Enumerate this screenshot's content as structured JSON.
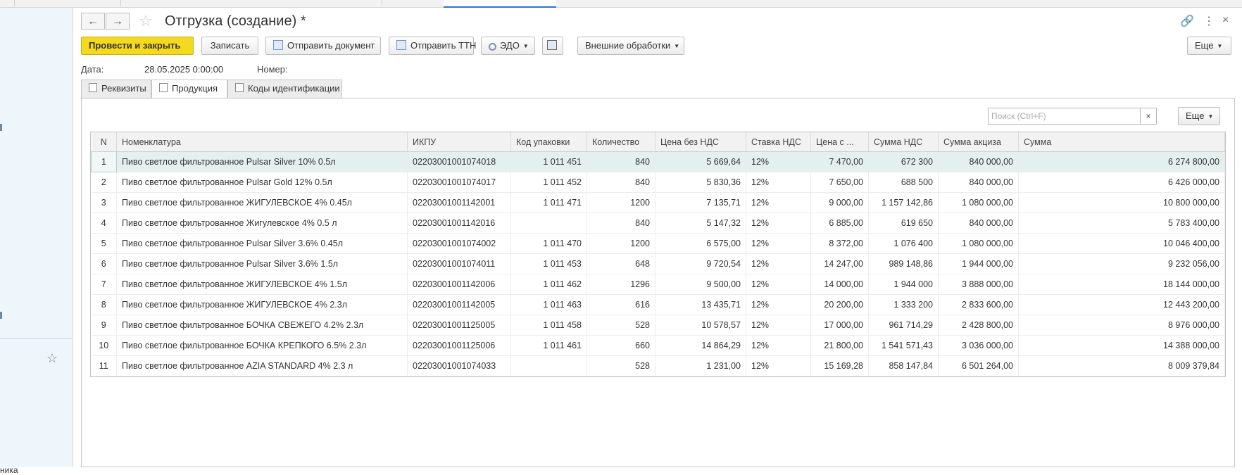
{
  "header": {
    "title": "Отгрузка (создание) *",
    "back_icon": "←",
    "forward_icon": "→",
    "star_icon": "☆",
    "link_icon": "🔗",
    "menu_icon": "⋮",
    "close_icon": "×"
  },
  "toolbar": {
    "post_close": "Провести и закрыть",
    "write": "Записать",
    "send_doc": "Отправить документ",
    "send_ttn": "Отправить ТТН",
    "edo": "ЭДО",
    "external": "Внешние обработки",
    "more": "Еще"
  },
  "fields": {
    "date_label": "Дата:",
    "date_value": "28.05.2025  0:00:00",
    "number_label": "Номер:",
    "number_value": ""
  },
  "tabs": [
    {
      "label": "Реквизиты"
    },
    {
      "label": "Продукция"
    },
    {
      "label": "Коды идентификации"
    }
  ],
  "search": {
    "placeholder": "Поиск (Ctrl+F)",
    "clear": "×",
    "more": "Еще"
  },
  "left_panel": {
    "star": "☆",
    "fragment": "ника"
  },
  "table": {
    "columns": [
      "N",
      "Номенклатура",
      "ИКПУ",
      "Код упаковки",
      "Количество",
      "Цена без НДС",
      "Ставка НДС",
      "Цена с ...",
      "Сумма НДС",
      "Сумма акциза",
      "Сумма"
    ],
    "rows": [
      [
        "1",
        "Пиво светлое фильтрованное Pulsar Silver 10% 0.5л",
        "02203001001074018",
        "1 011 451",
        "840",
        "5 669,64",
        "12%",
        "7 470,00",
        "672 300",
        "840 000,00",
        "6 274 800,00"
      ],
      [
        "2",
        "Пиво светлое фильтрованное Pulsar Gold 12% 0.5л",
        "02203001001074017",
        "1 011 452",
        "840",
        "5 830,36",
        "12%",
        "7 650,00",
        "688 500",
        "840 000,00",
        "6 426 000,00"
      ],
      [
        "3",
        "Пиво светлое фильтрованное ЖИГУЛЕВСКОЕ 4% 0.45л",
        "02203001001142001",
        "1 011 471",
        "1200",
        "7 135,71",
        "12%",
        "9 000,00",
        "1 157 142,86",
        "1 080 000,00",
        "10 800 000,00"
      ],
      [
        "4",
        "Пиво светлое фильтрованное Жигулевское 4% 0.5 л",
        "02203001001142016",
        "",
        "840",
        "5 147,32",
        "12%",
        "6 885,00",
        "619 650",
        "840 000,00",
        "5 783 400,00"
      ],
      [
        "5",
        "Пиво светлое фильтрованное Pulsar Silver 3.6% 0.45л",
        "02203001001074002",
        "1 011 470",
        "1200",
        "6 575,00",
        "12%",
        "8 372,00",
        "1 076 400",
        "1 080 000,00",
        "10 046 400,00"
      ],
      [
        "6",
        "Пиво светлое фильтрованное Pulsar Silver 3.6% 1.5л",
        "02203001001074011",
        "1 011 453",
        "648",
        "9 720,54",
        "12%",
        "14 247,00",
        "989 148,86",
        "1 944 000,00",
        "9 232 056,00"
      ],
      [
        "7",
        "Пиво светлое фильтрованное ЖИГУЛЕВСКОЕ 4% 1.5л",
        "02203001001142006",
        "1 011 462",
        "1296",
        "9 500,00",
        "12%",
        "14 000,00",
        "1 944 000",
        "3 888 000,00",
        "18 144 000,00"
      ],
      [
        "8",
        "Пиво светлое фильтрованное ЖИГУЛЕВСКОЕ 4% 2.3л",
        "02203001001142005",
        "1 011 463",
        "616",
        "13 435,71",
        "12%",
        "20 200,00",
        "1 333 200",
        "2 833 600,00",
        "12 443 200,00"
      ],
      [
        "9",
        "Пиво светлое фильтрованное БОЧКА СВЕЖЕГО 4.2% 2.3л",
        "02203001001125005",
        "1 011 458",
        "528",
        "10 578,57",
        "12%",
        "17 000,00",
        "961 714,29",
        "2 428 800,00",
        "8 976 000,00"
      ],
      [
        "10",
        "Пиво светлое фильтрованное БОЧКА КРЕПКОГО  6.5% 2.3л",
        "02203001001125006",
        "1 011 461",
        "660",
        "14 864,29",
        "12%",
        "21 800,00",
        "1 541 571,43",
        "3 036 000,00",
        "14 388 000,00"
      ],
      [
        "11",
        "Пиво светлое фильтрованное AZIA STANDARD 4% 2.3 л",
        "02203001001074033",
        "",
        "528",
        "1 231,00",
        "12%",
        "15 169,28",
        "858 147,84",
        "6 501 264,00",
        "8 009 379,84"
      ]
    ]
  }
}
